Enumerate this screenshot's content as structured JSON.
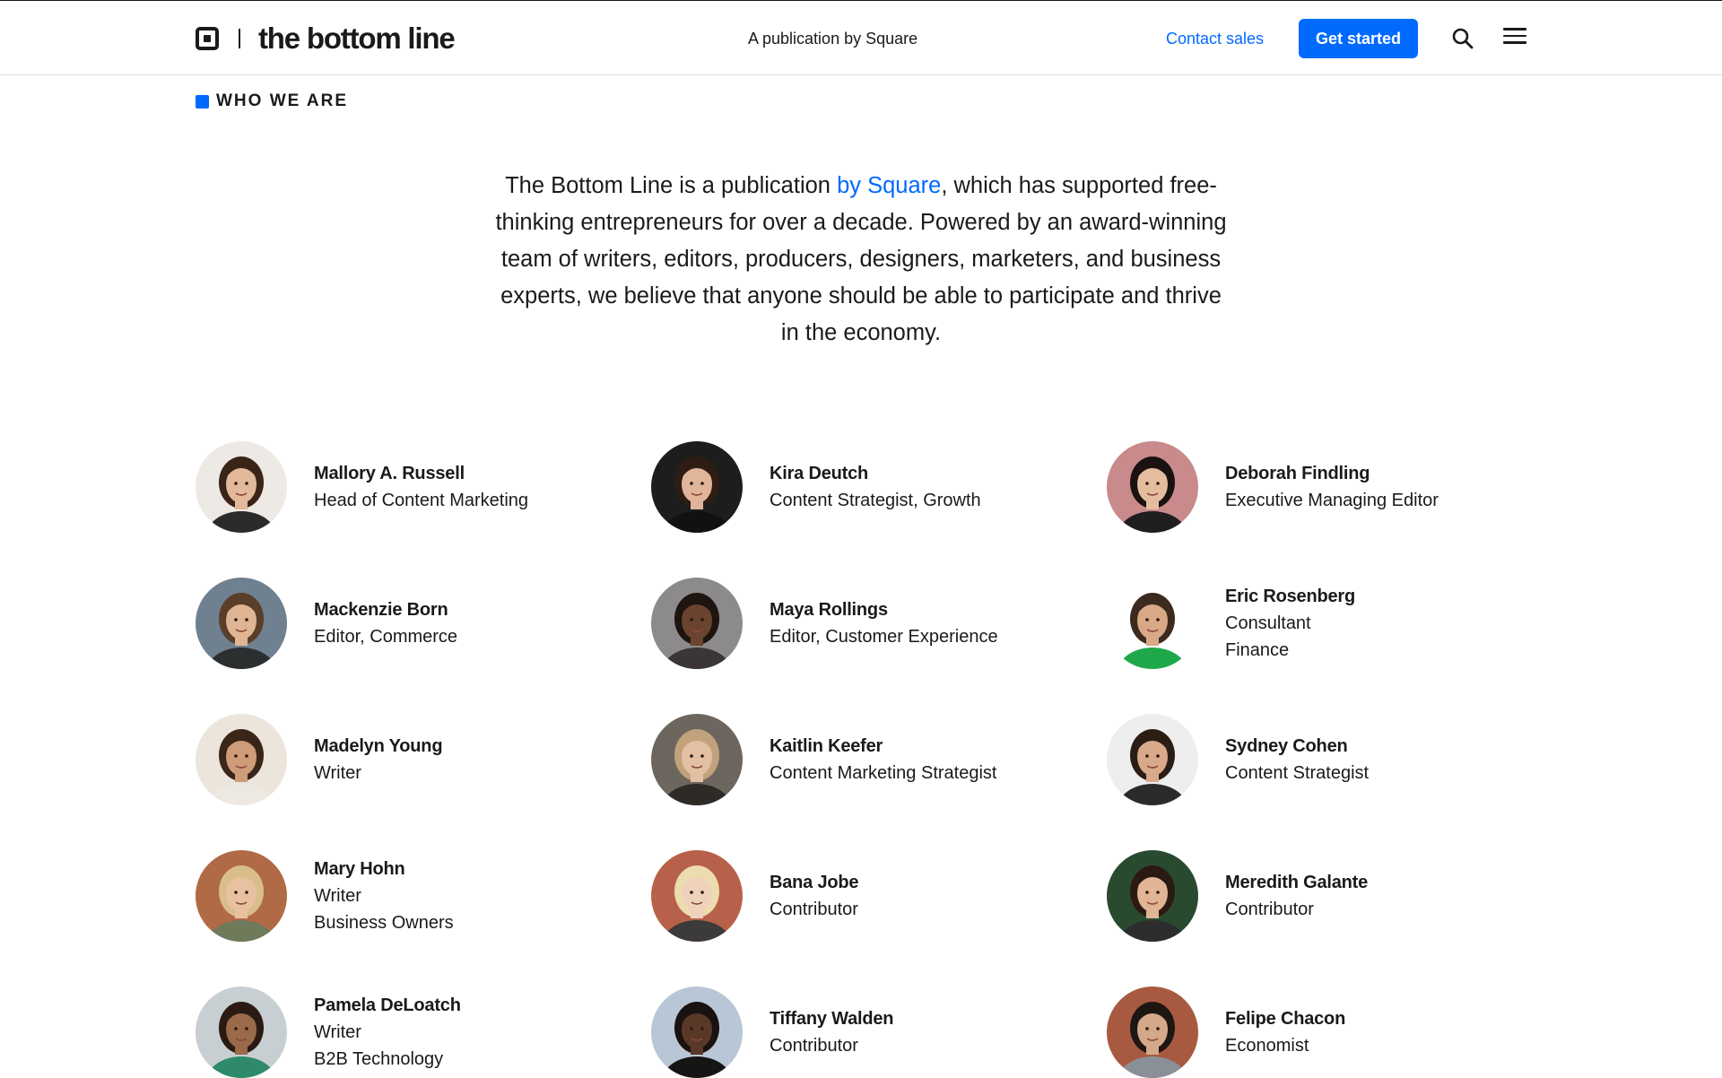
{
  "header": {
    "logo": "the bottom line",
    "tagline": "A publication by Square",
    "contact_label": "Contact sales",
    "cta_label": "Get started",
    "icons": {
      "logo": "square-logo-icon",
      "search": "search-icon",
      "menu": "hamburger-menu-icon"
    }
  },
  "section": {
    "label": "WHO WE ARE",
    "intro_before": "The Bottom Line is a publication ",
    "intro_link": "by Square",
    "intro_after": ", which has supported free-thinking entrepreneurs for over a decade. Powered by an award-winning team of writers, editors, producers, designers, marketers, and business experts, we believe that anyone should be able to participate and thrive in the economy."
  },
  "colors": {
    "accent": "#006aff",
    "text": "#1a1a1a",
    "border": "#e0e0e0"
  },
  "team": [
    {
      "name": "Mallory A. Russell",
      "roles": [
        "Head of Content Marketing"
      ],
      "bg": "#ede9e4",
      "skin": "#e2b99a",
      "hair": "#3a2418",
      "shirt": "#2b2b2b"
    },
    {
      "name": "Kira Deutch",
      "roles": [
        "Content Strategist, Growth"
      ],
      "bg": "#1d1d1d",
      "skin": "#e1b59a",
      "hair": "#2e1d14",
      "shirt": "#111111"
    },
    {
      "name": "Deborah Findling",
      "roles": [
        "Executive Managing Editor"
      ],
      "bg": "#c98a8c",
      "skin": "#e4bd9f",
      "hair": "#1a1210",
      "shirt": "#1e1e1e"
    },
    {
      "name": "Mackenzie Born",
      "roles": [
        "Editor, Commerce"
      ],
      "bg": "#6f8090",
      "skin": "#dfb594",
      "hair": "#5a3e28",
      "shirt": "#2c2f30"
    },
    {
      "name": "Maya Rollings",
      "roles": [
        "Editor, Customer Experience"
      ],
      "bg": "#8c8a8a",
      "skin": "#6a4430",
      "hair": "#1e1410",
      "shirt": "#3b3535"
    },
    {
      "name": "Eric Rosenberg",
      "roles": [
        "Consultant",
        "Finance"
      ],
      "bg": "#ffffff",
      "skin": "#d9a886",
      "hair": "#3c2a1e",
      "shirt": "#1fa84a"
    },
    {
      "name": "Madelyn Young",
      "roles": [
        "Writer"
      ],
      "bg": "#ece5dc",
      "skin": "#cf9c7a",
      "hair": "#3a2618",
      "shirt": "#ede8e1"
    },
    {
      "name": "Kaitlin Keefer",
      "roles": [
        "Content Marketing Strategist"
      ],
      "bg": "#6d665e",
      "skin": "#e3c0a4",
      "hair": "#c2a27c",
      "shirt": "#2e2a26"
    },
    {
      "name": "Sydney Cohen",
      "roles": [
        "Content Strategist"
      ],
      "bg": "#eeeeee",
      "skin": "#d8a98a",
      "hair": "#2c1d14",
      "shirt": "#2a2a2a"
    },
    {
      "name": "Mary Hohn",
      "roles": [
        "Writer",
        "Business Owners"
      ],
      "bg": "#b06a45",
      "skin": "#e8c2a0",
      "hair": "#d9be8c",
      "shirt": "#6e7a5a"
    },
    {
      "name": "Bana Jobe",
      "roles": [
        "Contributor"
      ],
      "bg": "#b8614a",
      "skin": "#efd2bb",
      "hair": "#ecdcae",
      "shirt": "#3c3a3a"
    },
    {
      "name": "Meredith Galante",
      "roles": [
        "Contributor"
      ],
      "bg": "#2a4a30",
      "skin": "#e0b494",
      "hair": "#2a1a12",
      "shirt": "#2d2d2d"
    },
    {
      "name": "Pamela DeLoatch",
      "roles": [
        "Writer",
        "B2B Technology"
      ],
      "bg": "#c8cfd2",
      "skin": "#9a6a4a",
      "hair": "#2a1a12",
      "shirt": "#2e8a6a"
    },
    {
      "name": "Tiffany Walden",
      "roles": [
        "Contributor"
      ],
      "bg": "#b8c6d6",
      "skin": "#5a3828",
      "hair": "#1a1210",
      "shirt": "#151515"
    },
    {
      "name": "Felipe Chacon",
      "roles": [
        "Economist"
      ],
      "bg": "#a85a40",
      "skin": "#d4a888",
      "hair": "#1e1612",
      "shirt": "#8a9098"
    }
  ]
}
